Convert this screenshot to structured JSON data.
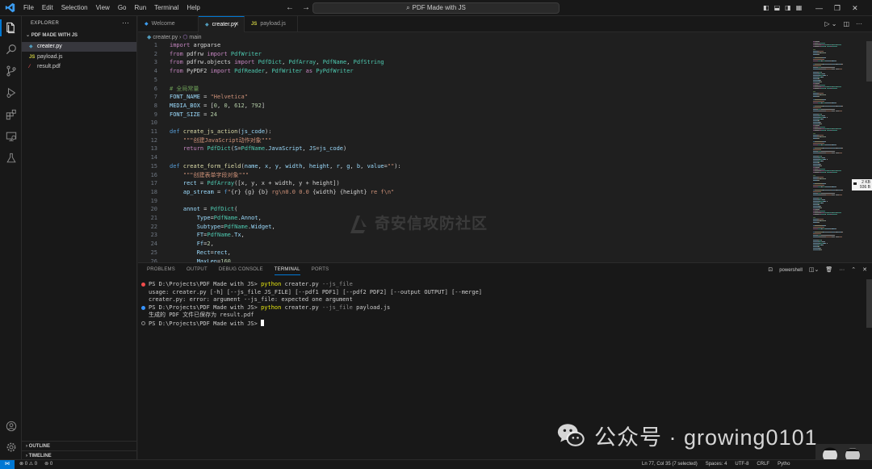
{
  "titlebar": {
    "menu": [
      "File",
      "Edit",
      "Selection",
      "View",
      "Go",
      "Run",
      "Terminal",
      "Help"
    ],
    "search_text": "PDF Made with JS"
  },
  "sidebar": {
    "title": "EXPLORER",
    "folder": "PDF MADE WITH JS",
    "files": [
      {
        "name": "creater.py",
        "icon": "python-file-icon",
        "badge": "",
        "selected": true,
        "color": "#ffffff"
      },
      {
        "name": "payload.js",
        "icon": "js-file-icon",
        "badge": "JS",
        "selected": false,
        "color": "#cccccc"
      },
      {
        "name": "result.pdf",
        "icon": "pdf-file-icon",
        "badge": "",
        "selected": false,
        "color": "#cccccc"
      }
    ],
    "sections": [
      "OUTLINE",
      "TIMELINE"
    ]
  },
  "tabs": [
    {
      "label": "Welcome",
      "icon": "vscode-icon",
      "active": false
    },
    {
      "label": "creater.py",
      "icon": "python-file-icon",
      "active": true
    },
    {
      "label": "payload.js",
      "icon": "js-file-icon",
      "badge": "JS",
      "active": false
    }
  ],
  "breadcrumb": {
    "file": "creater.py",
    "symbol": "main"
  },
  "code_lines": [
    [
      [
        "k",
        "import"
      ],
      [
        "p",
        " argparse"
      ]
    ],
    [
      [
        "k",
        "from"
      ],
      [
        "p",
        " pdfrw "
      ],
      [
        "k",
        "import"
      ],
      [
        "t",
        " PdfWriter"
      ]
    ],
    [
      [
        "k",
        "from"
      ],
      [
        "p",
        " pdfrw.objects "
      ],
      [
        "k",
        "import"
      ],
      [
        "t",
        " PdfDict"
      ],
      [
        "p",
        ", "
      ],
      [
        "t",
        "PdfArray"
      ],
      [
        "p",
        ", "
      ],
      [
        "t",
        "PdfName"
      ],
      [
        "p",
        ", "
      ],
      [
        "t",
        "PdfString"
      ]
    ],
    [
      [
        "k",
        "from"
      ],
      [
        "p",
        " PyPDF2 "
      ],
      [
        "k",
        "import"
      ],
      [
        "t",
        " PdfReader"
      ],
      [
        "p",
        ", "
      ],
      [
        "t",
        "PdfWriter"
      ],
      [
        "k",
        " as"
      ],
      [
        "t",
        " PyPdfWriter"
      ]
    ],
    [],
    [
      [
        "c",
        "# 全局常量"
      ]
    ],
    [
      [
        "v",
        "FONT_NAME"
      ],
      [
        "p",
        " = "
      ],
      [
        "s",
        "\"Helvetica\""
      ]
    ],
    [
      [
        "v",
        "MEDIA_BOX"
      ],
      [
        "p",
        " = ["
      ],
      [
        "n",
        "0"
      ],
      [
        "p",
        ", "
      ],
      [
        "n",
        "0"
      ],
      [
        "p",
        ", "
      ],
      [
        "n",
        "612"
      ],
      [
        "p",
        ", "
      ],
      [
        "n",
        "792"
      ],
      [
        "p",
        "]"
      ]
    ],
    [
      [
        "v",
        "FONT_SIZE"
      ],
      [
        "p",
        " = "
      ],
      [
        "n",
        "24"
      ]
    ],
    [],
    [
      [
        "kb",
        "def"
      ],
      [
        "f",
        " create_js_action"
      ],
      [
        "p",
        "("
      ],
      [
        "v",
        "js_code"
      ],
      [
        "p",
        "):"
      ]
    ],
    [
      [
        "s",
        "    \"\"\"创建JavaScript动作对象\"\"\""
      ]
    ],
    [
      [
        "k",
        "    return"
      ],
      [
        "t",
        " PdfDict"
      ],
      [
        "p",
        "("
      ],
      [
        "v",
        "S"
      ],
      [
        "p",
        "="
      ],
      [
        "t",
        "PdfName"
      ],
      [
        "p",
        "."
      ],
      [
        "v",
        "JavaScript"
      ],
      [
        "p",
        ", "
      ],
      [
        "v",
        "JS"
      ],
      [
        "p",
        "="
      ],
      [
        "v",
        "js_code"
      ],
      [
        "p",
        ")"
      ]
    ],
    [],
    [
      [
        "kb",
        "def"
      ],
      [
        "f",
        " create_form_field"
      ],
      [
        "p",
        "("
      ],
      [
        "v",
        "name"
      ],
      [
        "p",
        ", "
      ],
      [
        "v",
        "x"
      ],
      [
        "p",
        ", "
      ],
      [
        "v",
        "y"
      ],
      [
        "p",
        ", "
      ],
      [
        "v",
        "width"
      ],
      [
        "p",
        ", "
      ],
      [
        "v",
        "height"
      ],
      [
        "p",
        ", "
      ],
      [
        "v",
        "r"
      ],
      [
        "p",
        ", "
      ],
      [
        "v",
        "g"
      ],
      [
        "p",
        ", "
      ],
      [
        "v",
        "b"
      ],
      [
        "p",
        ", "
      ],
      [
        "v",
        "value"
      ],
      [
        "p",
        "="
      ],
      [
        "s",
        "\"\""
      ],
      [
        "p",
        "):"
      ]
    ],
    [
      [
        "s",
        "    \"\"\"创建表单字段对象\"\"\""
      ]
    ],
    [
      [
        "v",
        "    rect"
      ],
      [
        "p",
        " = "
      ],
      [
        "t",
        "PdfArray"
      ],
      [
        "p",
        "([x, y, x + width, y + height])"
      ]
    ],
    [
      [
        "v",
        "    ap_stream"
      ],
      [
        "p",
        " = "
      ],
      [
        "kb",
        "f"
      ],
      [
        "s",
        "\""
      ],
      [
        "p",
        "{r}"
      ],
      [
        "s",
        " "
      ],
      [
        "p",
        "{g}"
      ],
      [
        "s",
        " "
      ],
      [
        "p",
        "{b}"
      ],
      [
        "s",
        " rg\\n0.0 0.0 "
      ],
      [
        "p",
        "{width}"
      ],
      [
        "s",
        " "
      ],
      [
        "p",
        "{height}"
      ],
      [
        "s",
        " re f\\n\""
      ]
    ],
    [],
    [
      [
        "v",
        "    annot"
      ],
      [
        "p",
        " = "
      ],
      [
        "t",
        "PdfDict"
      ],
      [
        "p",
        "("
      ]
    ],
    [
      [
        "v",
        "        Type"
      ],
      [
        "p",
        "="
      ],
      [
        "t",
        "PdfName"
      ],
      [
        "p",
        "."
      ],
      [
        "v",
        "Annot"
      ],
      [
        "p",
        ","
      ]
    ],
    [
      [
        "v",
        "        Subtype"
      ],
      [
        "p",
        "="
      ],
      [
        "t",
        "PdfName"
      ],
      [
        "p",
        "."
      ],
      [
        "v",
        "Widget"
      ],
      [
        "p",
        ","
      ]
    ],
    [
      [
        "v",
        "        FT"
      ],
      [
        "p",
        "="
      ],
      [
        "t",
        "PdfName"
      ],
      [
        "p",
        "."
      ],
      [
        "v",
        "Tx"
      ],
      [
        "p",
        ","
      ]
    ],
    [
      [
        "v",
        "        Ff"
      ],
      [
        "p",
        "="
      ],
      [
        "n",
        "2"
      ],
      [
        "p",
        ","
      ]
    ],
    [
      [
        "v",
        "        Rect"
      ],
      [
        "p",
        "="
      ],
      [
        "v",
        "rect"
      ],
      [
        "p",
        ","
      ]
    ],
    [
      [
        "v",
        "        MaxLen"
      ],
      [
        "p",
        "="
      ],
      [
        "n",
        "160"
      ],
      [
        "p",
        ","
      ]
    ]
  ],
  "watermark": "奇安信攻防社区",
  "hover_info": [
    "2 KB",
    "936 B"
  ],
  "panel": {
    "tabs": [
      "PROBLEMS",
      "OUTPUT",
      "DEBUG CONSOLE",
      "TERMINAL",
      "PORTS"
    ],
    "active_tab": "TERMINAL",
    "shell": "powershell",
    "terminal": [
      {
        "dot": "red",
        "segs": [
          [
            "p",
            "PS D:\\Projects\\PDF Made with JS> "
          ],
          [
            "cmd",
            "python"
          ],
          [
            "p",
            " creater.py "
          ],
          [
            "arg",
            "--js_file"
          ]
        ]
      },
      {
        "dot": "",
        "segs": [
          [
            "p",
            "usage: creater.py [-h] [--js_file JS_FILE] [--pdf1 PDF1] [--pdf2 PDF2] [--output OUTPUT] [--merge]"
          ]
        ]
      },
      {
        "dot": "",
        "segs": [
          [
            "p",
            "creater.py: error: argument --js_file: expected one argument"
          ]
        ]
      },
      {
        "dot": "blue",
        "segs": [
          [
            "p",
            "PS D:\\Projects\\PDF Made with JS> "
          ],
          [
            "cmd",
            "python"
          ],
          [
            "p",
            " creater.py "
          ],
          [
            "arg",
            "--js_file"
          ],
          [
            "p",
            " payload.js"
          ]
        ]
      },
      {
        "dot": "",
        "segs": [
          [
            "p",
            "生成的 PDF 文件已保存为 result.pdf"
          ]
        ]
      },
      {
        "dot": "hollow",
        "segs": [
          [
            "p",
            "PS D:\\Projects\\PDF Made with JS> "
          ]
        ],
        "cursor": true
      }
    ]
  },
  "wechat_text": "公众号 · growing0101",
  "status": {
    "remote": "⋈",
    "errors": "0",
    "warnings": "0",
    "ports": "0",
    "position": "Ln 77, Col 35 (7 selected)",
    "spaces": "Spaces: 4",
    "encoding": "UTF-8",
    "eol": "CRLF",
    "language": "Pytho"
  },
  "colors": {
    "accent": "#0078d4",
    "background": "#1f1f1f",
    "chrome": "#181818"
  }
}
